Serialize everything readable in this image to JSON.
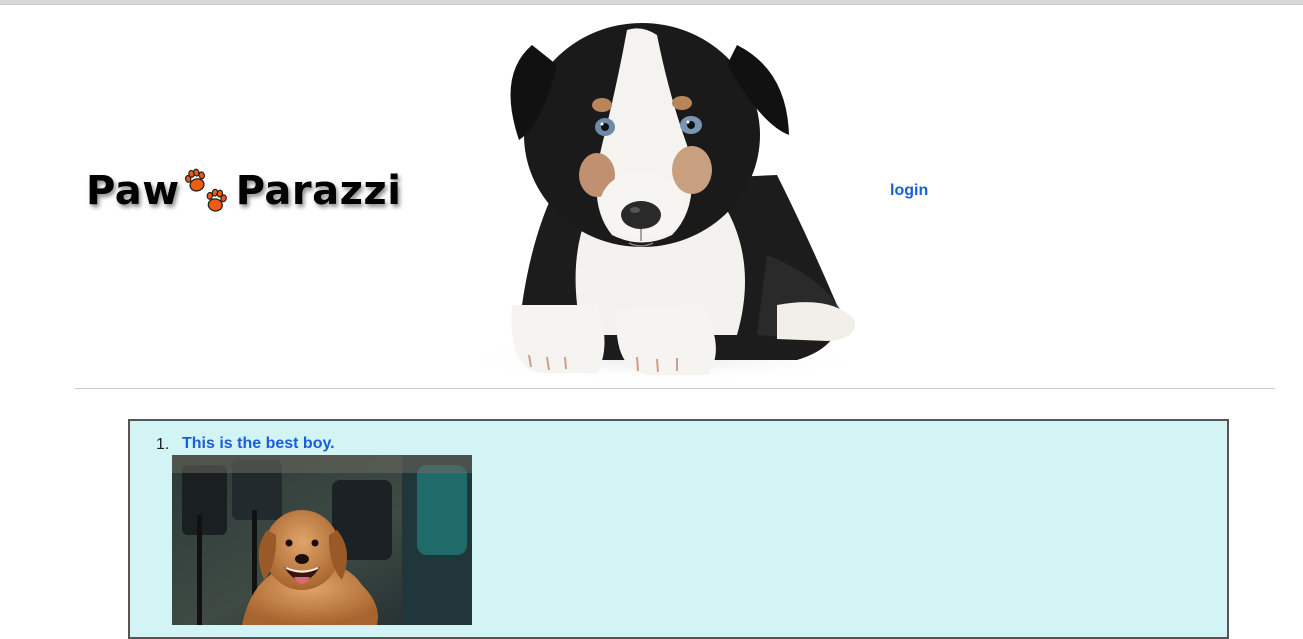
{
  "header": {
    "logo_left": "Paw",
    "logo_right": "Parazzi",
    "login_label": "login"
  },
  "feed": {
    "posts": [
      {
        "number": "1.",
        "title": "This is the best boy."
      }
    ]
  },
  "colors": {
    "link": "#1a5fd6",
    "feed_background": "#d3f4f5",
    "feed_border": "#555555",
    "paw": "#f05a12"
  },
  "icons": {
    "logo_paws": "paw-prints-icon"
  }
}
